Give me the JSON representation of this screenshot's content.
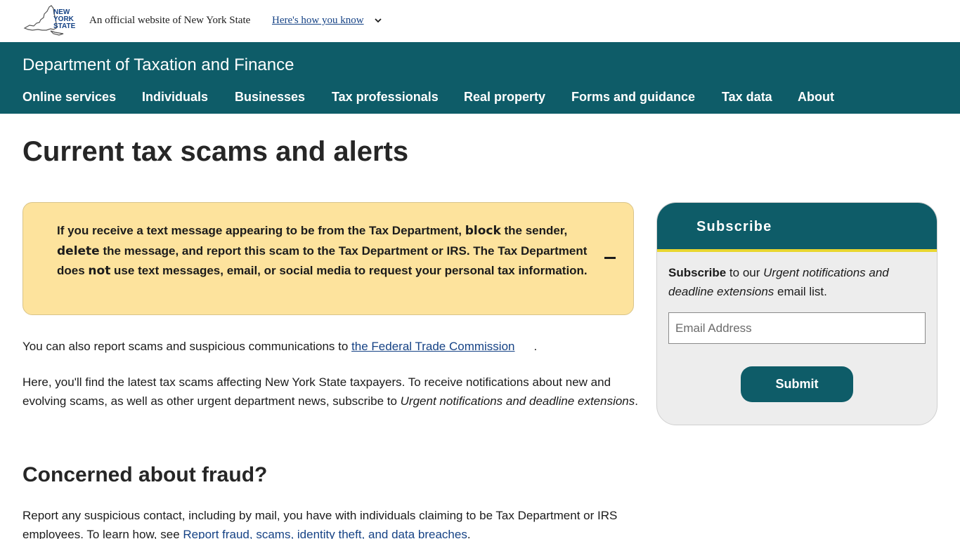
{
  "banner": {
    "logo_text_lines": [
      "NEW",
      "YORK",
      "STATE"
    ],
    "official_text": "An official website of New York State",
    "how_you_know": "Here's how you know"
  },
  "header": {
    "agency_title": "Department of Taxation and Finance",
    "nav": [
      {
        "label": "Online services"
      },
      {
        "label": "Individuals"
      },
      {
        "label": "Businesses"
      },
      {
        "label": "Tax professionals"
      },
      {
        "label": "Real property"
      },
      {
        "label": "Forms and guidance"
      },
      {
        "label": "Tax data"
      },
      {
        "label": "About"
      }
    ]
  },
  "page": {
    "title": "Current tax scams and alerts"
  },
  "alert": {
    "part1": "If you receive a text message appearing to be from the Tax Department, ",
    "bold1": "block",
    "part2": " the sender, ",
    "bold2": "delete",
    "part3": " the message, and report this scam to the Tax Department or IRS. The Tax Department does ",
    "bold3": "not",
    "part4": " use text messages, email, or social media to request your personal tax information."
  },
  "content": {
    "p1_text": "You can also report scams and suspicious communications to ",
    "p1_link": "the Federal Trade Commission",
    "p1_end": ".",
    "p2_text": "Here, you'll find the latest tax scams affecting New York State taxpayers. To receive notifications about new and evolving scams, as well as other urgent department news, subscribe to ",
    "p2_italic": "Urgent notifications and deadline extensions",
    "p2_end": ".",
    "h2": "Concerned about fraud?",
    "p3_text": "Report any suspicious contact, including by mail, you have with individuals claiming to be Tax Department or IRS employees. To learn how, see ",
    "p3_link": "Report fraud, scams, identity theft, and data breaches",
    "p3_end": "."
  },
  "subscribe": {
    "title": "Subscribe",
    "desc_bold": "Subscribe",
    "desc_text": " to our ",
    "desc_italic": "Urgent notifications and deadline extensions",
    "desc_end": " email list.",
    "email_placeholder": "Email Address",
    "submit_label": "Submit"
  },
  "colors": {
    "brand_teal": "#0e5c68",
    "alert_yellow": "#fde39d",
    "accent_gold": "#e8d62f",
    "link_blue": "#154285"
  }
}
